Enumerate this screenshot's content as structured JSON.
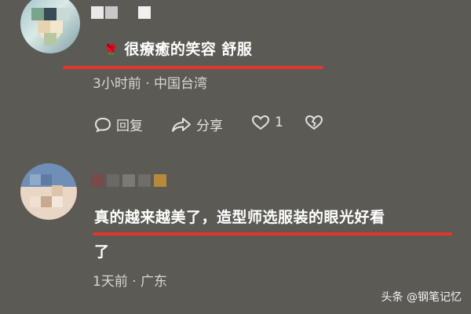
{
  "comments": [
    {
      "emoji": "🌹",
      "text": "很療癒的笑容 舒服",
      "time": "3小时前",
      "location": "中国台湾",
      "actions": {
        "reply_label": "回复",
        "share_label": "分享",
        "like_count": "1"
      }
    },
    {
      "text_line1": "真的越来越美了，造型师选服装的眼光好看",
      "text_line2": "了",
      "time": "1天前",
      "location": "广东"
    }
  ],
  "separator": "·",
  "watermark": {
    "platform": "头条",
    "author": "@钢笔记忆"
  },
  "colors": {
    "background": "#5b5a55",
    "underline": "#e5352a",
    "text": "#ffffff",
    "meta": "#d7d7d2"
  }
}
